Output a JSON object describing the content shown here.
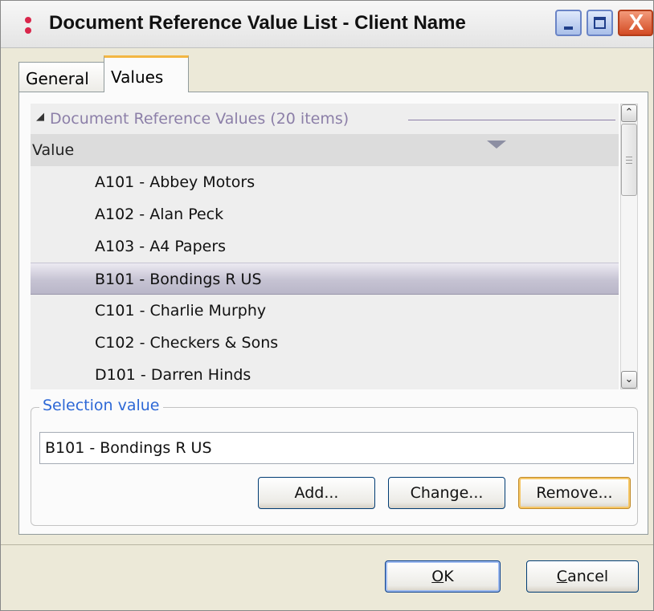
{
  "window": {
    "title": "Document Reference Value List - Client Name",
    "close_glyph": "X"
  },
  "tabs": [
    {
      "label": "General",
      "active": false
    },
    {
      "label": "Values",
      "active": true
    }
  ],
  "list": {
    "group_header": "Document Reference Values (20 items)",
    "group_expand_glyph": "◢",
    "column_header": "Value",
    "rows": [
      "A101 - Abbey Motors",
      "A102 - Alan Peck",
      "A103 - A4 Papers",
      "B101 - Bondings R US",
      "C101 - Charlie Murphy",
      "C102 - Checkers & Sons",
      "D101 - Darren Hinds"
    ],
    "selected_row": "B101 - Bondings R US"
  },
  "scrollbar": {
    "up_glyph": "⌃",
    "down_glyph": "⌄"
  },
  "selection": {
    "legend": "Selection value",
    "value": "B101 - Bondings R US",
    "add_label": "Add...",
    "change_label": "Change...",
    "remove_label": "Remove..."
  },
  "footer": {
    "ok_mnemonic": "O",
    "ok_rest": "K",
    "cancel_mnemonic": "C",
    "cancel_rest": "ancel"
  },
  "icons": {
    "app": "app-dots-icon",
    "minimize": "minimize-icon",
    "maximize": "maximize-icon",
    "close": "close-icon",
    "group_toggle": "triangle-expand-icon",
    "sort": "sort-down-icon",
    "scroll_up": "chevron-up-icon",
    "scroll_down": "chevron-down-icon"
  },
  "colors": {
    "tab_accent": "#f3b642",
    "group_header_text": "#8c7fa8",
    "legend_text": "#2d68d6",
    "close_button": "#d34b24"
  }
}
